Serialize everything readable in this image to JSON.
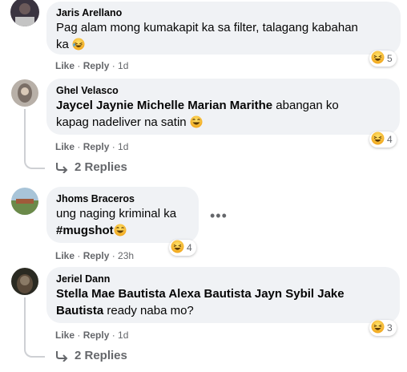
{
  "comments": [
    {
      "name": "Jaris Arellano",
      "text1": "Pag alam mong kumakapit ka sa filter, talagang kabahan",
      "text2": "ka",
      "like": "Like",
      "reply": "Reply",
      "time": "1d",
      "reaction_count": "5"
    },
    {
      "name": "Ghel Velasco",
      "tags": "Jaycel Jaynie Michelle Marian Marithe",
      "text1_rest": " abangan ko",
      "text2": "kapag nadeliver na satin",
      "like": "Like",
      "reply": "Reply",
      "time": "1d",
      "reaction_count": "4",
      "replies_label": "2 Replies"
    },
    {
      "name": "Jhoms Braceros",
      "text1": "ung naging kriminal ka",
      "hashtag": "#mugshot",
      "like": "Like",
      "reply": "Reply",
      "time": "23h",
      "reaction_count": "4"
    },
    {
      "name": "Jeriel Dann",
      "tags1": "Stella Mae Bautista Alexa Bautista Jayn Sybil Jake",
      "tags2": "Bautista",
      "text2_rest": " ready naba mo?",
      "like": "Like",
      "reply": "Reply",
      "time": "1d",
      "reaction_count": "3",
      "replies_label": "2 Replies"
    }
  ],
  "separator": " · ",
  "colors": {
    "bubble": "#f0f2f5",
    "meta": "#65676b",
    "thread": "#ced0d4",
    "emoji": "#f7b125"
  },
  "icons": {
    "reaction": "haha-emoji-icon",
    "inline_emoji": "laughing-emoji-icon",
    "reply_arrow": "reply-arrow-icon",
    "more": "more-options-icon"
  }
}
